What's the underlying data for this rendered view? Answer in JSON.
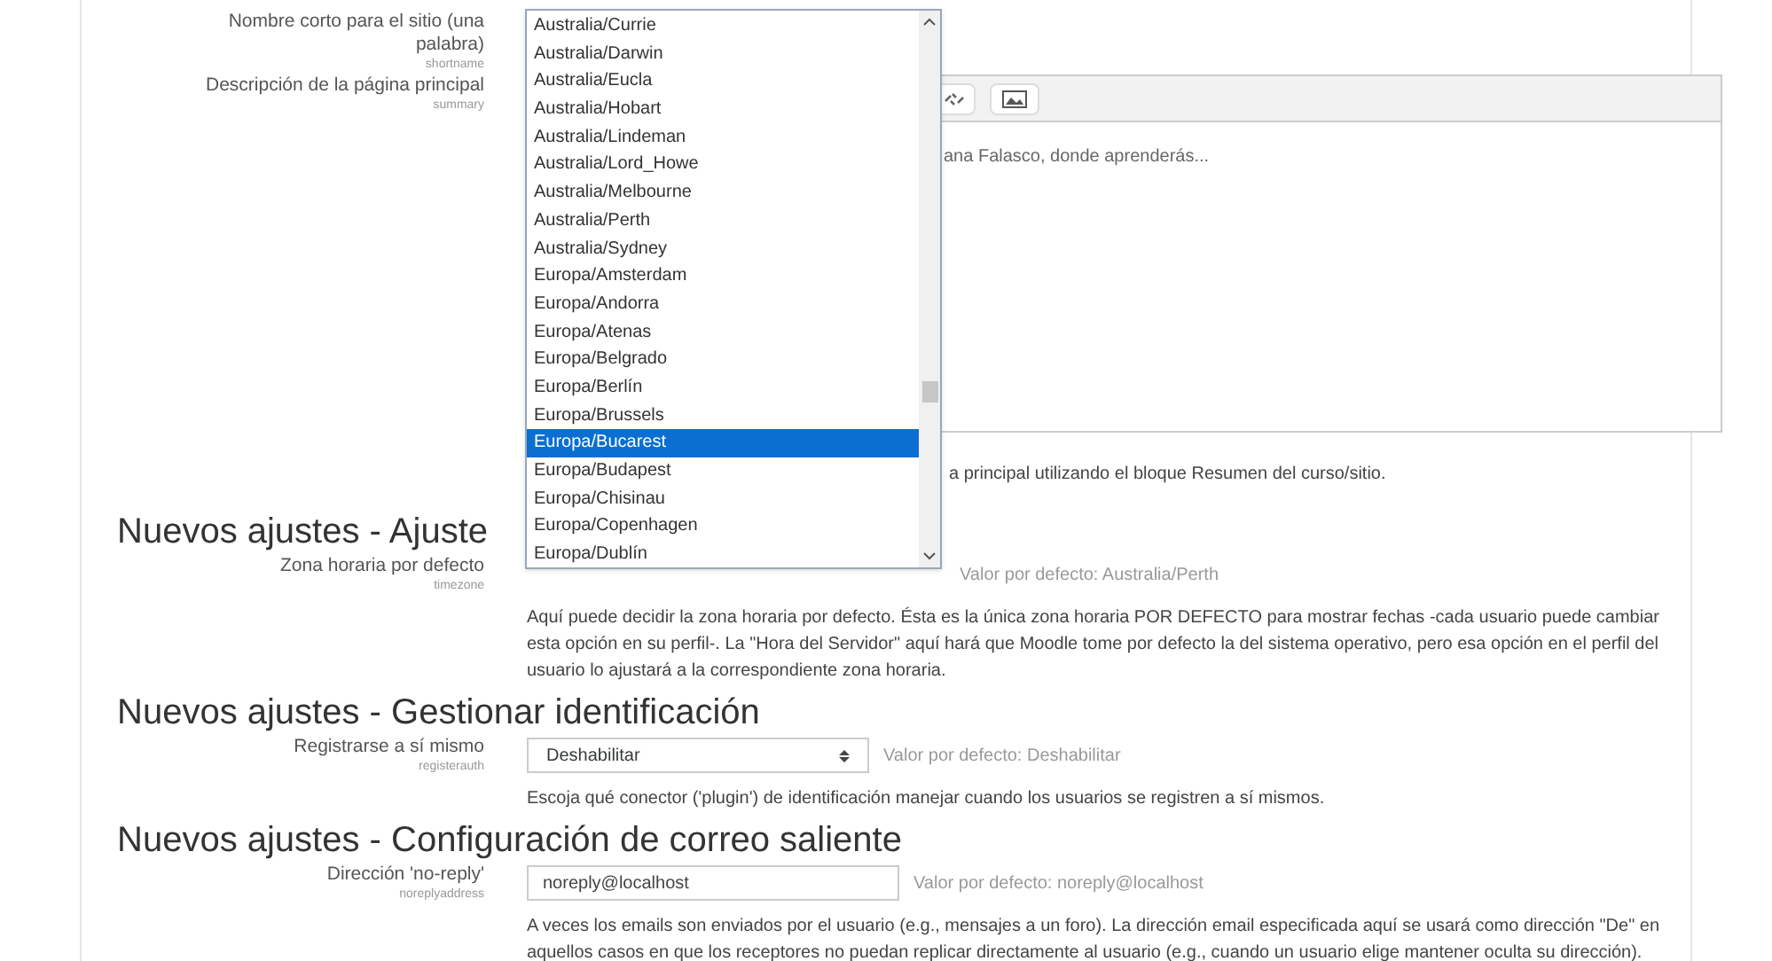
{
  "top_settings": [
    {
      "label": "Nombre corto para el sitio (una palabra)",
      "key": "shortname"
    },
    {
      "label": "Descripción de la página principal",
      "key": "summary"
    }
  ],
  "summary_editor": {
    "content": "ana Falasco, donde aprenderás...",
    "help": "a principal utilizando el bloque Resumen del curso/sitio."
  },
  "sections": [
    {
      "heading": "Nuevos ajustes - Ajuste",
      "setting": {
        "kind": "open-select",
        "label": "Zona horaria por defecto",
        "key": "timezone",
        "default": "Valor por defecto: Australia/Perth",
        "help": "Aquí puede decidir la zona horaria por defecto. Ésta es la única zona horaria POR DEFECTO para mostrar fechas -cada usuario puede cambiar esta opción en su perfil-. La \"Hora del Servidor\" aquí hará que Moodle tome por defecto la del sistema operativo, pero esa opción en el perfil del usuario lo ajustará a la correspondiente zona horaria."
      }
    },
    {
      "heading": "Nuevos ajustes - Gestionar identificación",
      "setting": {
        "kind": "select",
        "label": "Registrarse a sí mismo",
        "key": "registerauth",
        "value": "Deshabilitar",
        "default": "Valor por defecto: Deshabilitar",
        "help": "Escoja qué conector ('plugin') de identificación manejar cuando los usuarios se registren a sí mismos."
      }
    },
    {
      "heading": "Nuevos ajustes - Configuración de correo saliente",
      "setting": {
        "kind": "text",
        "label": "Dirección 'no-reply'",
        "key": "noreplyaddress",
        "value": "noreply@localhost",
        "default": "Valor por defecto: noreply@localhost",
        "help": "A veces los emails son enviados por el usuario (e.g., mensajes a un foro). La dirección email especificada aquí se usará como dirección \"De\" en aquellos casos en que los receptores no puedan replicar directamente al usuario (e.g., cuando un usuario elige mantener oculta su dirección)."
      }
    }
  ],
  "timezone_dropdown": {
    "options": [
      {
        "label": "Australia/Currie",
        "selected": false
      },
      {
        "label": "Australia/Darwin",
        "selected": false
      },
      {
        "label": "Australia/Eucla",
        "selected": false
      },
      {
        "label": "Australia/Hobart",
        "selected": false
      },
      {
        "label": "Australia/Lindeman",
        "selected": false
      },
      {
        "label": "Australia/Lord_Howe",
        "selected": false
      },
      {
        "label": "Australia/Melbourne",
        "selected": false
      },
      {
        "label": "Australia/Perth",
        "selected": false
      },
      {
        "label": "Australia/Sydney",
        "selected": false
      },
      {
        "label": "Europa/Amsterdam",
        "selected": false
      },
      {
        "label": "Europa/Andorra",
        "selected": false
      },
      {
        "label": "Europa/Atenas",
        "selected": false
      },
      {
        "label": "Europa/Belgrado",
        "selected": false
      },
      {
        "label": "Europa/Berlín",
        "selected": false
      },
      {
        "label": "Europa/Brussels",
        "selected": false
      },
      {
        "label": "Europa/Bucarest",
        "selected": true
      },
      {
        "label": "Europa/Budapest",
        "selected": false
      },
      {
        "label": "Europa/Chisinau",
        "selected": false
      },
      {
        "label": "Europa/Copenhagen",
        "selected": false
      },
      {
        "label": "Europa/Dublín",
        "selected": false
      }
    ]
  }
}
